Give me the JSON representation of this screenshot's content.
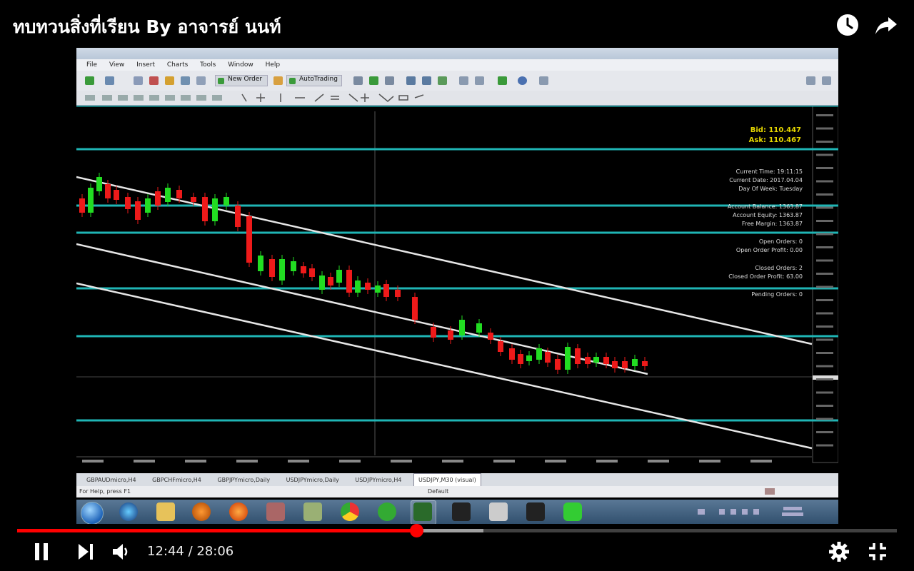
{
  "video": {
    "title": "ทบทวนสิ่งที่เรียน By อาจารย์ นนท์",
    "current_time": "12:44",
    "duration": "28:06",
    "time_display": "12:44 / 28:06",
    "progress_fraction": 0.454,
    "buffered_fraction": 0.53
  },
  "icons": {
    "watch_later": "clock-icon",
    "share": "share-arrow-icon",
    "play_pause": "pause-icon",
    "next": "skip-next-icon",
    "volume": "volume-icon",
    "settings": "gear-icon",
    "fullscreen_exit": "exit-fullscreen-icon"
  },
  "platform": {
    "menu": [
      "File",
      "View",
      "Insert",
      "Charts",
      "Tools",
      "Window",
      "Help"
    ],
    "toolbar": {
      "new_order": "New Order",
      "auto_trading": "AutoTrading"
    },
    "tabs": [
      "GBPAUDmicro,H4",
      "GBPCHFmicro,H4",
      "GBPJPYmicro,Daily",
      "USDJPYmicro,Daily",
      "USDJPYmicro,H4",
      "USDJPY,M30 (visual)"
    ],
    "active_tab_index": 5,
    "status_left": "For Help, press F1",
    "status_mid": "Default",
    "chart_info": {
      "bid": "Bid: 110.447",
      "ask": "Ask: 110.467",
      "lines": [
        "Current Time: 19:11:15",
        "Current Date: 2017.04.04",
        "Day Of Week: Tuesday",
        "",
        "Account Balance: 1363.87",
        "Account Equity: 1363.87",
        "Free Margin: 1363.87",
        "",
        "Open Orders: 0",
        "Open Order Profit: 0.00",
        "",
        "Closed Orders: 2",
        "Closed Order Profit: 63.00",
        "",
        "Pending Orders: 0"
      ]
    }
  },
  "colors": {
    "progress": "#ff0000",
    "horizontal_line": "#1fb5b5",
    "bull_candle": "#22dd22",
    "bear_candle": "#ee1a1a",
    "trend_line": "#e6e6e6",
    "bid_ask_text": "#e6d800"
  }
}
